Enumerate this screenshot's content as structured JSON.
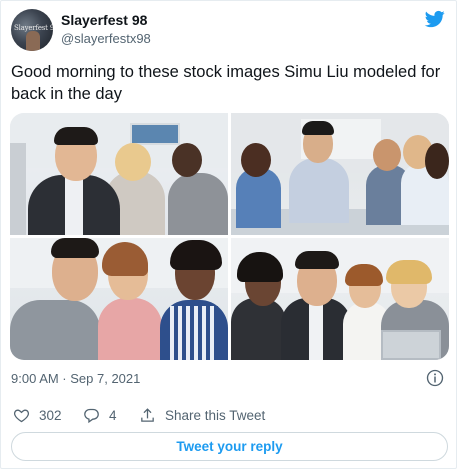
{
  "author": {
    "display_name": "Slayerfest 98",
    "handle": "@slayerfestx98",
    "avatar_text": "Slayerfest 98",
    "avatar_icon": "avatar-image"
  },
  "brand": {
    "icon": "twitter-bird-icon",
    "color": "#1d9bf0"
  },
  "tweet": {
    "text": "Good morning to these stock images Simu Liu modeled for back in the day",
    "media": [
      {
        "label": "stock-photo-office-team-1"
      },
      {
        "label": "stock-photo-office-meeting"
      },
      {
        "label": "stock-photo-smiling-group"
      },
      {
        "label": "stock-photo-laptop-team"
      }
    ]
  },
  "meta": {
    "timestamp": "9:00 AM · Sep 7, 2021",
    "info_icon": "info-icon"
  },
  "actions": {
    "like_count": "302",
    "reply_count": "4",
    "share_label": "Share this Tweet"
  },
  "reply_button": {
    "label": "Tweet your reply"
  },
  "colors": {
    "text": "#0f1419",
    "secondary": "#536471",
    "accent": "#1d9bf0",
    "border": "#cfd9de"
  }
}
